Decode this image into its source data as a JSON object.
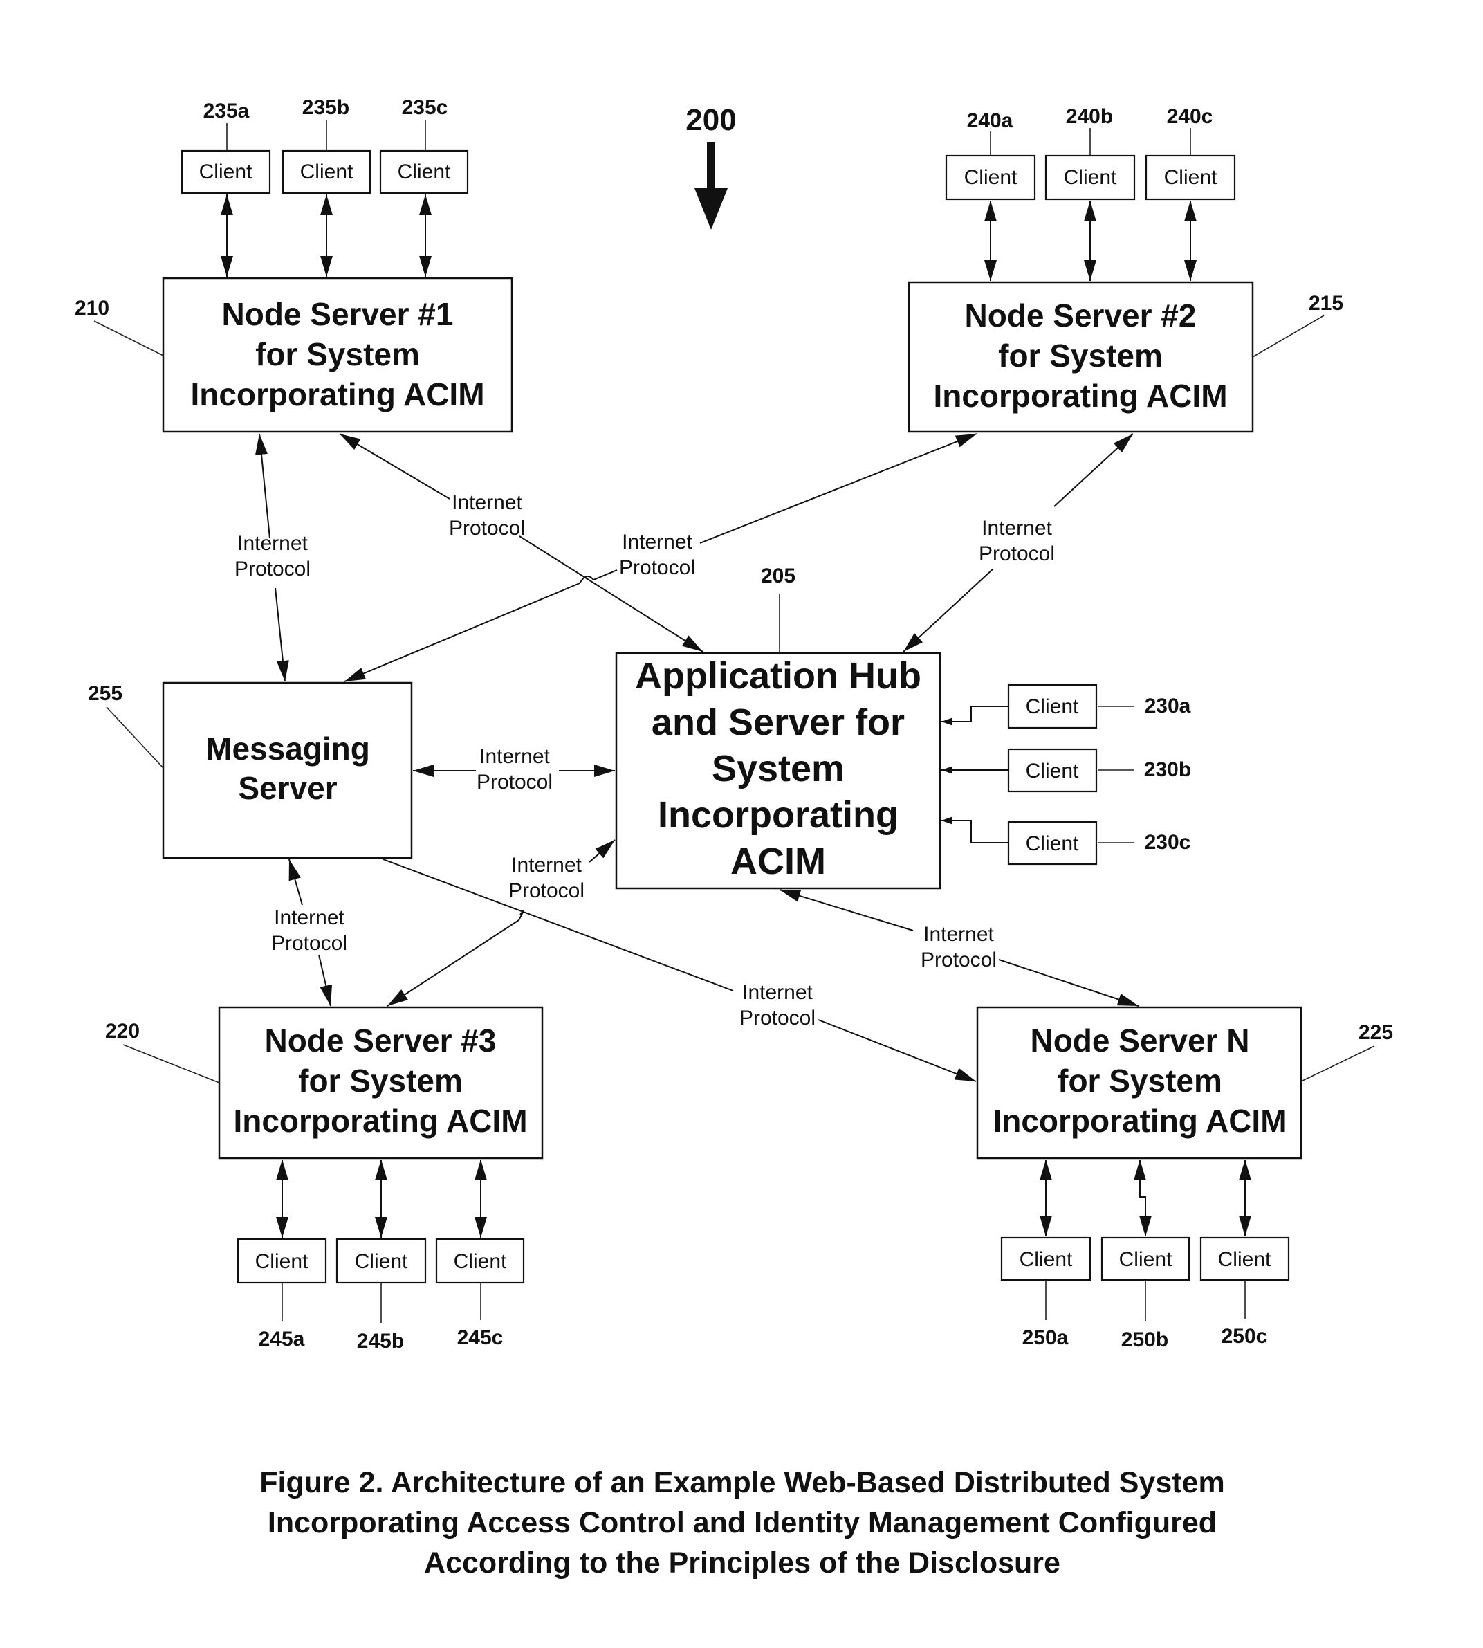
{
  "figure": {
    "number_label": "200",
    "caption_lines": [
      "Figure 2. Architecture of an Example Web-Based Distributed System",
      "Incorporating Access Control and Identity Management Configured",
      "According to the Principles of the Disclosure"
    ]
  },
  "connection_label": {
    "line1": "Internet",
    "line2": "Protocol"
  },
  "client_label": "Client",
  "nodes": {
    "hub": {
      "ref": "205",
      "lines": [
        "Application Hub",
        "and Server for",
        "System",
        "Incorporating",
        "ACIM"
      ]
    },
    "node1": {
      "ref": "210",
      "lines": [
        "Node Server #1",
        "for System",
        "Incorporating ACIM"
      ]
    },
    "node2": {
      "ref": "215",
      "lines": [
        "Node Server #2",
        "for System",
        "Incorporating ACIM"
      ]
    },
    "node3": {
      "ref": "220",
      "lines": [
        "Node Server #3",
        "for System",
        "Incorporating ACIM"
      ]
    },
    "nodeN": {
      "ref": "225",
      "lines": [
        "Node Server N",
        "for System",
        "Incorporating ACIM"
      ]
    },
    "messaging": {
      "ref": "255",
      "lines": [
        "Messaging",
        "Server"
      ]
    }
  },
  "clients": {
    "node1": [
      "235a",
      "235b",
      "235c"
    ],
    "node2": [
      "240a",
      "240b",
      "240c"
    ],
    "hub": [
      "230a",
      "230b",
      "230c"
    ],
    "node3": [
      "245a",
      "245b",
      "245c"
    ],
    "nodeN": [
      "250a",
      "250b",
      "250c"
    ]
  }
}
